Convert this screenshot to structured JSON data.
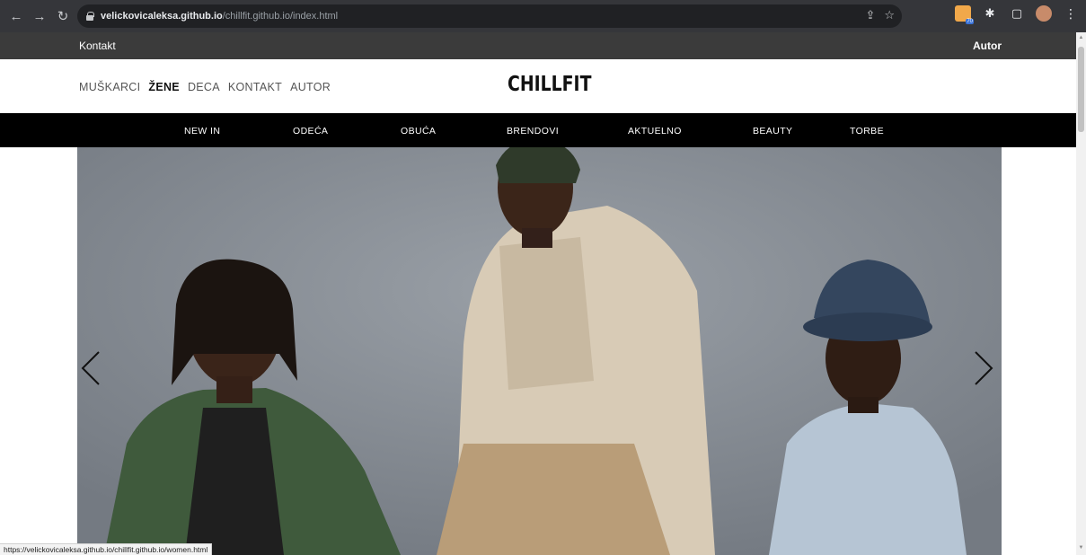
{
  "browser": {
    "url_host": "velickovicaleksa.github.io",
    "url_path": "/chillfit.github.io/index.html",
    "status_url": "https://velickovicaleksa.github.io/chillfit.github.io/women.html",
    "feed_badge": "70"
  },
  "topbar": {
    "left_link": "Kontakt",
    "right_link": "Autor"
  },
  "header": {
    "logo": "CHILLFIT",
    "gender_nav": [
      {
        "label": "MUŠKARCI",
        "active": false
      },
      {
        "label": "ŽENE",
        "active": true
      },
      {
        "label": "DECA",
        "active": false
      },
      {
        "label": "KONTAKT",
        "active": false
      },
      {
        "label": "AUTOR",
        "active": false
      }
    ]
  },
  "categories": [
    "NEW IN",
    "ODEĆA",
    "OBUĆA",
    "BRENDOVI",
    "AKTUELNO",
    "BEAUTY",
    "TORBE"
  ],
  "hero": {
    "icons": {
      "prev": "chevron-left-icon",
      "next": "chevron-right-icon"
    }
  },
  "colors": {
    "topbar_bg": "#3b3b3b",
    "category_bar_bg": "#000000",
    "hero_bg": "#80868d"
  }
}
